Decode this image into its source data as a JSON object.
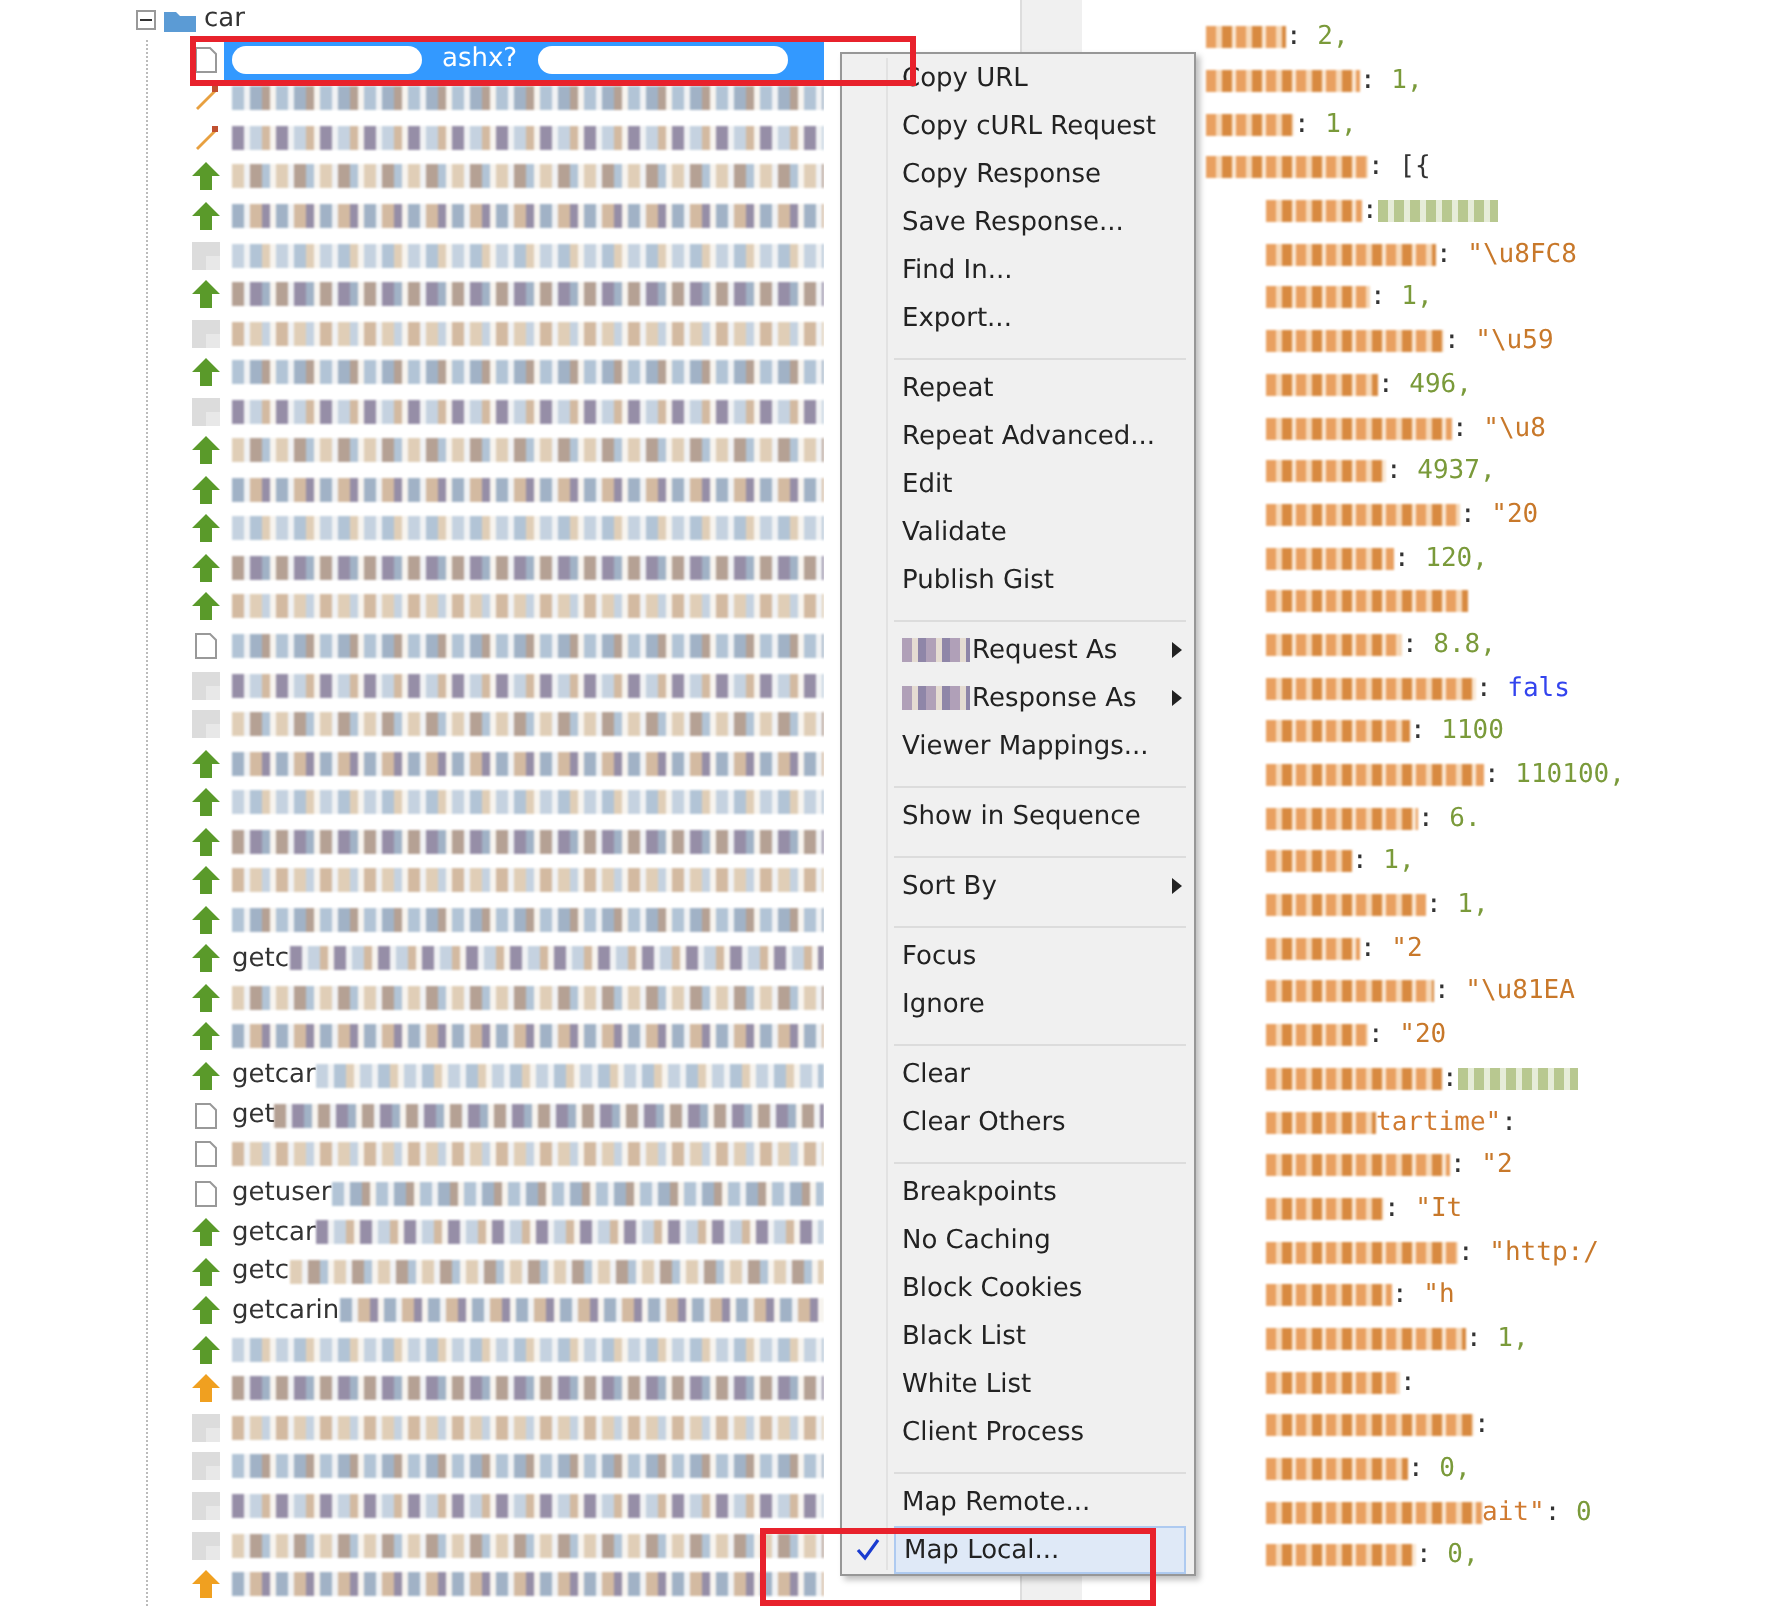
{
  "tree": {
    "folder": {
      "label": "car",
      "expanded": true
    },
    "rows": [
      {
        "kind": "doc",
        "selected": true,
        "visible_text": "ashx?"
      },
      {
        "kind": "pencil",
        "selected": false
      },
      {
        "kind": "pencil",
        "selected": false
      },
      {
        "kind": "up",
        "selected": false
      },
      {
        "kind": "up",
        "selected": false
      },
      {
        "kind": "blur",
        "selected": false
      },
      {
        "kind": "up",
        "selected": false
      },
      {
        "kind": "blur",
        "selected": false
      },
      {
        "kind": "up",
        "selected": false
      },
      {
        "kind": "blur",
        "selected": false
      },
      {
        "kind": "up",
        "selected": false
      },
      {
        "kind": "up",
        "selected": false
      },
      {
        "kind": "up",
        "selected": false
      },
      {
        "kind": "up",
        "selected": false
      },
      {
        "kind": "up",
        "selected": false
      },
      {
        "kind": "doc",
        "selected": false
      },
      {
        "kind": "blur",
        "selected": false
      },
      {
        "kind": "blur",
        "selected": false
      },
      {
        "kind": "up",
        "selected": false
      },
      {
        "kind": "up",
        "selected": false
      },
      {
        "kind": "up",
        "selected": false
      },
      {
        "kind": "up",
        "selected": false
      },
      {
        "kind": "up",
        "selected": false
      },
      {
        "kind": "up",
        "selected": false,
        "visible_text": "getc"
      },
      {
        "kind": "up",
        "selected": false
      },
      {
        "kind": "up",
        "selected": false
      },
      {
        "kind": "up",
        "selected": false,
        "visible_text": "getcar"
      },
      {
        "kind": "doc",
        "selected": false,
        "visible_text": "get"
      },
      {
        "kind": "doc",
        "selected": false
      },
      {
        "kind": "doc",
        "selected": false,
        "visible_text": "getuser"
      },
      {
        "kind": "up",
        "selected": false,
        "visible_text": "getcar"
      },
      {
        "kind": "up",
        "selected": false,
        "visible_text": "getc"
      },
      {
        "kind": "up",
        "selected": false,
        "visible_text": "getcarin"
      },
      {
        "kind": "up",
        "selected": false
      },
      {
        "kind": "orange",
        "selected": false
      },
      {
        "kind": "blur",
        "selected": false
      },
      {
        "kind": "blur",
        "selected": false
      },
      {
        "kind": "blur",
        "selected": false
      },
      {
        "kind": "blur",
        "selected": false
      },
      {
        "kind": "orange",
        "selected": false
      }
    ]
  },
  "context_menu": [
    {
      "kind": "item",
      "label": "Copy URL",
      "checked": false
    },
    {
      "kind": "item",
      "label": "Copy cURL Request",
      "checked": false
    },
    {
      "kind": "item",
      "label": "Copy Response",
      "checked": false
    },
    {
      "kind": "item",
      "label": "Save Response...",
      "checked": false
    },
    {
      "kind": "item",
      "label": "Find In...",
      "checked": false
    },
    {
      "kind": "item",
      "label": "Export...",
      "checked": false
    },
    {
      "kind": "separator"
    },
    {
      "kind": "item",
      "label": "Repeat",
      "checked": false
    },
    {
      "kind": "item",
      "label": "Repeat Advanced...",
      "checked": false
    },
    {
      "kind": "item",
      "label": "Edit",
      "checked": false
    },
    {
      "kind": "item",
      "label": "Validate",
      "checked": false
    },
    {
      "kind": "item",
      "label": "Publish Gist",
      "checked": false
    },
    {
      "kind": "separator"
    },
    {
      "kind": "submenu",
      "label": "Request As",
      "blurred_prefix": true
    },
    {
      "kind": "submenu",
      "label": "Response As",
      "blurred_prefix": true
    },
    {
      "kind": "item",
      "label": "Viewer Mappings...",
      "checked": false
    },
    {
      "kind": "separator"
    },
    {
      "kind": "item",
      "label": "Show in Sequence",
      "checked": false
    },
    {
      "kind": "separator"
    },
    {
      "kind": "submenu",
      "label": "Sort By",
      "blurred_prefix": false
    },
    {
      "kind": "separator"
    },
    {
      "kind": "item",
      "label": "Focus",
      "checked": false
    },
    {
      "kind": "item",
      "label": "Ignore",
      "checked": false
    },
    {
      "kind": "separator"
    },
    {
      "kind": "item",
      "label": "Clear",
      "checked": false
    },
    {
      "kind": "item",
      "label": "Clear Others",
      "checked": false
    },
    {
      "kind": "separator"
    },
    {
      "kind": "item",
      "label": "Breakpoints",
      "checked": false
    },
    {
      "kind": "item",
      "label": "No Caching",
      "checked": false
    },
    {
      "kind": "item",
      "label": "Block Cookies",
      "checked": false
    },
    {
      "kind": "item",
      "label": "Black List",
      "checked": false
    },
    {
      "kind": "item",
      "label": "White List",
      "checked": false
    },
    {
      "kind": "item",
      "label": "Client Process",
      "checked": false
    },
    {
      "kind": "separator"
    },
    {
      "kind": "item",
      "label": "Map Remote...",
      "checked": false
    },
    {
      "kind": "item",
      "label": "Map Local...",
      "checked": true
    }
  ],
  "json_view": {
    "root_lines": [
      {
        "sep": ": ",
        "value": "2,",
        "kind": "number"
      },
      {
        "sep": ": ",
        "value": "1,",
        "kind": "number"
      },
      {
        "sep": ": ",
        "value": "1,",
        "kind": "number"
      },
      {
        "sep": ": ",
        "value": "[{",
        "kind": "bracket"
      }
    ],
    "nested_lines": [
      {
        "sep": ": ",
        "kind": "blurred"
      },
      {
        "sep": ": ",
        "value": "\"\\u8FC8",
        "kind": "string"
      },
      {
        "sep": ": ",
        "value": "1,",
        "kind": "number"
      },
      {
        "sep": ": ",
        "value": "\"\\u59",
        "kind": "string"
      },
      {
        "sep": ": ",
        "value": "496,",
        "kind": "number"
      },
      {
        "sep": ": ",
        "value": "\"\\u8",
        "kind": "string"
      },
      {
        "sep": ": ",
        "value": "4937,",
        "kind": "number"
      },
      {
        "sep": ": ",
        "value": "\"20",
        "kind": "string"
      },
      {
        "sep": ": ",
        "value": "120,",
        "kind": "number"
      },
      {
        "kind": "none"
      },
      {
        "sep": ": ",
        "value": "8.8,",
        "kind": "number"
      },
      {
        "sep": ": ",
        "value": "fals",
        "kind": "boolean"
      },
      {
        "sep": ": ",
        "value": "1100",
        "kind": "number"
      },
      {
        "sep": ": ",
        "value": "110100,",
        "kind": "number"
      },
      {
        "sep": ": ",
        "value": "6.",
        "kind": "number"
      },
      {
        "sep": ": ",
        "value": "1,",
        "kind": "number"
      },
      {
        "sep": ": ",
        "value": "1,",
        "kind": "number"
      },
      {
        "sep": ": ",
        "value": "\"2",
        "kind": "string"
      },
      {
        "sep": ": ",
        "value": "\"\\u81EA",
        "kind": "string"
      },
      {
        "sep": ": ",
        "value": "\"20",
        "kind": "string"
      },
      {
        "sep": ": ",
        "kind": "blurred"
      },
      {
        "key_tail": "tartime\"",
        "sep": ":",
        "kind": "none"
      },
      {
        "sep": ": ",
        "value": "\"2",
        "kind": "string"
      },
      {
        "sep": ": ",
        "value": "\"It",
        "kind": "string"
      },
      {
        "sep": ": ",
        "value": "\"http:/",
        "kind": "string"
      },
      {
        "sep": ": ",
        "value": "\"h",
        "kind": "string"
      },
      {
        "sep": ": ",
        "value": "1,",
        "kind": "number"
      },
      {
        "sep": ":",
        "kind": "none"
      },
      {
        "sep": ":",
        "kind": "none"
      },
      {
        "sep": ": ",
        "value": "0,",
        "kind": "number"
      },
      {
        "key_tail": "ait\"",
        "sep": ": ",
        "value": "0",
        "kind": "number"
      },
      {
        "sep": ": ",
        "value": "0,",
        "kind": "number"
      }
    ]
  }
}
